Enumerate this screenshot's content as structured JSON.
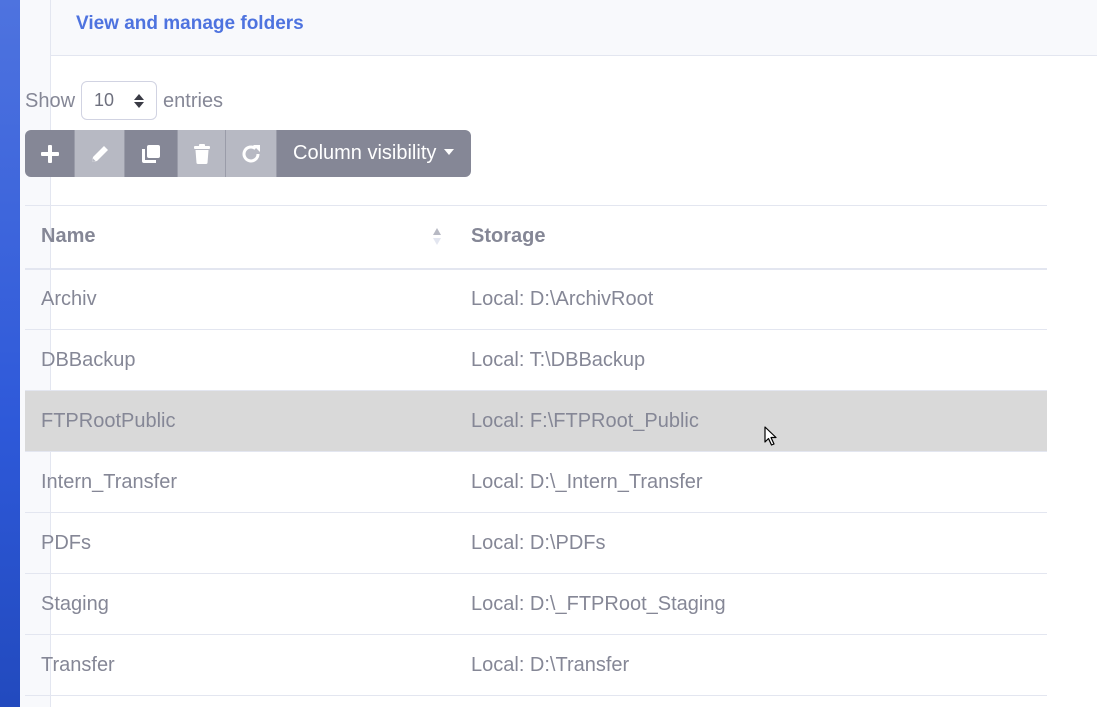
{
  "colors": {
    "accent": "#4e73df",
    "button": "#858796",
    "button_disabled": "#b7b9c3",
    "selected_row": "#d9d9d9"
  },
  "header": {
    "title": "View and manage folders"
  },
  "length": {
    "show_label": "Show",
    "value": "10",
    "entries_label": "entries"
  },
  "toolbar": {
    "add_icon": "plus-icon",
    "edit_icon": "pencil-icon",
    "copy_icon": "copy-icon",
    "delete_icon": "trash-icon",
    "refresh_icon": "refresh-icon",
    "column_visibility_label": "Column visibility"
  },
  "table": {
    "columns": [
      "Name",
      "Storage"
    ],
    "rows": [
      {
        "name": "Archiv",
        "storage": "Local: D:\\ArchivRoot"
      },
      {
        "name": "DBBackup",
        "storage": "Local: T:\\DBBackup"
      },
      {
        "name": "FTPRootPublic",
        "storage": "Local: F:\\FTPRoot_Public",
        "selected": true
      },
      {
        "name": "Intern_Transfer",
        "storage": "Local: D:\\_Intern_Transfer"
      },
      {
        "name": "PDFs",
        "storage": "Local: D:\\PDFs"
      },
      {
        "name": "Staging",
        "storage": "Local: D:\\_FTPRoot_Staging"
      },
      {
        "name": "Transfer",
        "storage": "Local: D:\\Transfer"
      }
    ]
  }
}
